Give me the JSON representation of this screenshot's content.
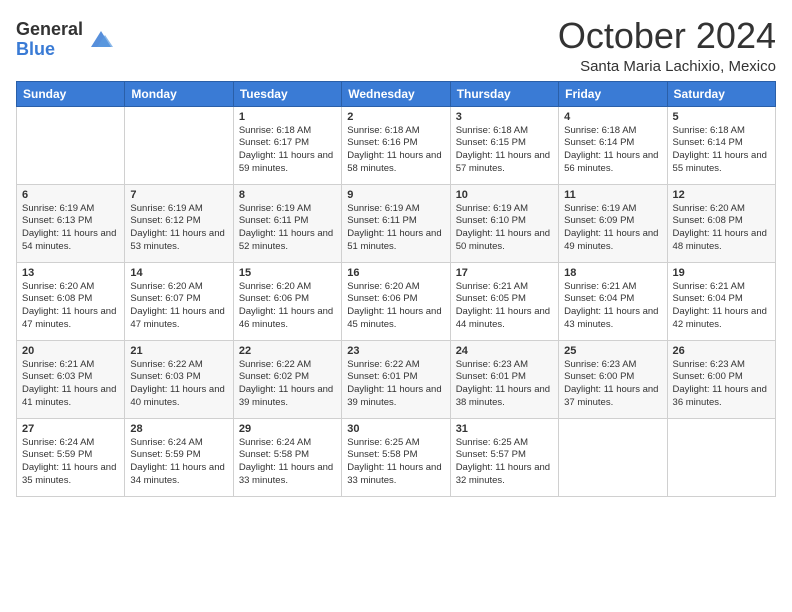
{
  "logo": {
    "general": "General",
    "blue": "Blue"
  },
  "header": {
    "month": "October 2024",
    "location": "Santa Maria Lachixio, Mexico"
  },
  "weekdays": [
    "Sunday",
    "Monday",
    "Tuesday",
    "Wednesday",
    "Thursday",
    "Friday",
    "Saturday"
  ],
  "weeks": [
    [
      {
        "day": "",
        "sunrise": "",
        "sunset": "",
        "daylight": ""
      },
      {
        "day": "",
        "sunrise": "",
        "sunset": "",
        "daylight": ""
      },
      {
        "day": "1",
        "sunrise": "Sunrise: 6:18 AM",
        "sunset": "Sunset: 6:17 PM",
        "daylight": "Daylight: 11 hours and 59 minutes."
      },
      {
        "day": "2",
        "sunrise": "Sunrise: 6:18 AM",
        "sunset": "Sunset: 6:16 PM",
        "daylight": "Daylight: 11 hours and 58 minutes."
      },
      {
        "day": "3",
        "sunrise": "Sunrise: 6:18 AM",
        "sunset": "Sunset: 6:15 PM",
        "daylight": "Daylight: 11 hours and 57 minutes."
      },
      {
        "day": "4",
        "sunrise": "Sunrise: 6:18 AM",
        "sunset": "Sunset: 6:14 PM",
        "daylight": "Daylight: 11 hours and 56 minutes."
      },
      {
        "day": "5",
        "sunrise": "Sunrise: 6:18 AM",
        "sunset": "Sunset: 6:14 PM",
        "daylight": "Daylight: 11 hours and 55 minutes."
      }
    ],
    [
      {
        "day": "6",
        "sunrise": "Sunrise: 6:19 AM",
        "sunset": "Sunset: 6:13 PM",
        "daylight": "Daylight: 11 hours and 54 minutes."
      },
      {
        "day": "7",
        "sunrise": "Sunrise: 6:19 AM",
        "sunset": "Sunset: 6:12 PM",
        "daylight": "Daylight: 11 hours and 53 minutes."
      },
      {
        "day": "8",
        "sunrise": "Sunrise: 6:19 AM",
        "sunset": "Sunset: 6:11 PM",
        "daylight": "Daylight: 11 hours and 52 minutes."
      },
      {
        "day": "9",
        "sunrise": "Sunrise: 6:19 AM",
        "sunset": "Sunset: 6:11 PM",
        "daylight": "Daylight: 11 hours and 51 minutes."
      },
      {
        "day": "10",
        "sunrise": "Sunrise: 6:19 AM",
        "sunset": "Sunset: 6:10 PM",
        "daylight": "Daylight: 11 hours and 50 minutes."
      },
      {
        "day": "11",
        "sunrise": "Sunrise: 6:19 AM",
        "sunset": "Sunset: 6:09 PM",
        "daylight": "Daylight: 11 hours and 49 minutes."
      },
      {
        "day": "12",
        "sunrise": "Sunrise: 6:20 AM",
        "sunset": "Sunset: 6:08 PM",
        "daylight": "Daylight: 11 hours and 48 minutes."
      }
    ],
    [
      {
        "day": "13",
        "sunrise": "Sunrise: 6:20 AM",
        "sunset": "Sunset: 6:08 PM",
        "daylight": "Daylight: 11 hours and 47 minutes."
      },
      {
        "day": "14",
        "sunrise": "Sunrise: 6:20 AM",
        "sunset": "Sunset: 6:07 PM",
        "daylight": "Daylight: 11 hours and 47 minutes."
      },
      {
        "day": "15",
        "sunrise": "Sunrise: 6:20 AM",
        "sunset": "Sunset: 6:06 PM",
        "daylight": "Daylight: 11 hours and 46 minutes."
      },
      {
        "day": "16",
        "sunrise": "Sunrise: 6:20 AM",
        "sunset": "Sunset: 6:06 PM",
        "daylight": "Daylight: 11 hours and 45 minutes."
      },
      {
        "day": "17",
        "sunrise": "Sunrise: 6:21 AM",
        "sunset": "Sunset: 6:05 PM",
        "daylight": "Daylight: 11 hours and 44 minutes."
      },
      {
        "day": "18",
        "sunrise": "Sunrise: 6:21 AM",
        "sunset": "Sunset: 6:04 PM",
        "daylight": "Daylight: 11 hours and 43 minutes."
      },
      {
        "day": "19",
        "sunrise": "Sunrise: 6:21 AM",
        "sunset": "Sunset: 6:04 PM",
        "daylight": "Daylight: 11 hours and 42 minutes."
      }
    ],
    [
      {
        "day": "20",
        "sunrise": "Sunrise: 6:21 AM",
        "sunset": "Sunset: 6:03 PM",
        "daylight": "Daylight: 11 hours and 41 minutes."
      },
      {
        "day": "21",
        "sunrise": "Sunrise: 6:22 AM",
        "sunset": "Sunset: 6:03 PM",
        "daylight": "Daylight: 11 hours and 40 minutes."
      },
      {
        "day": "22",
        "sunrise": "Sunrise: 6:22 AM",
        "sunset": "Sunset: 6:02 PM",
        "daylight": "Daylight: 11 hours and 39 minutes."
      },
      {
        "day": "23",
        "sunrise": "Sunrise: 6:22 AM",
        "sunset": "Sunset: 6:01 PM",
        "daylight": "Daylight: 11 hours and 39 minutes."
      },
      {
        "day": "24",
        "sunrise": "Sunrise: 6:23 AM",
        "sunset": "Sunset: 6:01 PM",
        "daylight": "Daylight: 11 hours and 38 minutes."
      },
      {
        "day": "25",
        "sunrise": "Sunrise: 6:23 AM",
        "sunset": "Sunset: 6:00 PM",
        "daylight": "Daylight: 11 hours and 37 minutes."
      },
      {
        "day": "26",
        "sunrise": "Sunrise: 6:23 AM",
        "sunset": "Sunset: 6:00 PM",
        "daylight": "Daylight: 11 hours and 36 minutes."
      }
    ],
    [
      {
        "day": "27",
        "sunrise": "Sunrise: 6:24 AM",
        "sunset": "Sunset: 5:59 PM",
        "daylight": "Daylight: 11 hours and 35 minutes."
      },
      {
        "day": "28",
        "sunrise": "Sunrise: 6:24 AM",
        "sunset": "Sunset: 5:59 PM",
        "daylight": "Daylight: 11 hours and 34 minutes."
      },
      {
        "day": "29",
        "sunrise": "Sunrise: 6:24 AM",
        "sunset": "Sunset: 5:58 PM",
        "daylight": "Daylight: 11 hours and 33 minutes."
      },
      {
        "day": "30",
        "sunrise": "Sunrise: 6:25 AM",
        "sunset": "Sunset: 5:58 PM",
        "daylight": "Daylight: 11 hours and 33 minutes."
      },
      {
        "day": "31",
        "sunrise": "Sunrise: 6:25 AM",
        "sunset": "Sunset: 5:57 PM",
        "daylight": "Daylight: 11 hours and 32 minutes."
      },
      {
        "day": "",
        "sunrise": "",
        "sunset": "",
        "daylight": ""
      },
      {
        "day": "",
        "sunrise": "",
        "sunset": "",
        "daylight": ""
      }
    ]
  ]
}
